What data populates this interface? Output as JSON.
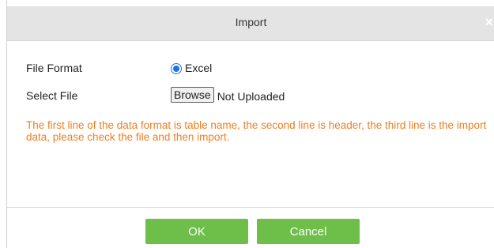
{
  "dialog": {
    "title": "Import",
    "close_glyph": "×"
  },
  "form": {
    "file_format_label": "File Format",
    "file_format_option": "Excel",
    "select_file_label": "Select File",
    "browse_label": "Browse",
    "upload_status": "Not Uploaded"
  },
  "note": "The first line of the data format is table name, the second line is header, the third line is the import data, please check the file and then import.",
  "buttons": {
    "ok_label": "OK",
    "cancel_label": "Cancel"
  },
  "colors": {
    "button_green": "#6dbf4a",
    "note_orange": "#ee7f22",
    "radio_blue": "#1a73e8",
    "titlebar_gray": "#e4e4e4"
  }
}
